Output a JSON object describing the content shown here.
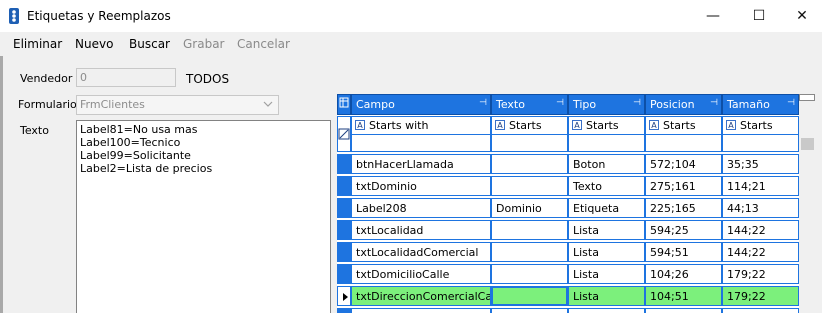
{
  "window": {
    "title": "Etiquetas y Reemplazos",
    "minimize": "—",
    "maximize": "☐",
    "close": "✕"
  },
  "menu": {
    "eliminar": "Eliminar",
    "nuevo": "Nuevo",
    "buscar": "Buscar",
    "grabar": "Grabar",
    "cancelar": "Cancelar"
  },
  "form": {
    "vendedor_label": "Vendedor",
    "vendedor_value": "0",
    "vendedor_desc": "TODOS",
    "formulario_label": "Formulario",
    "formulario_value": "FrmClientes",
    "texto_label": "Texto",
    "texto_lines": [
      "Label81=No usa mas",
      "Label100=Tecnico",
      "Label99=Solicitante",
      "Label2=Lista de precios"
    ]
  },
  "grid": {
    "columns": [
      "Campo",
      "Texto",
      "Tipo",
      "Posicion",
      "Tamaño"
    ],
    "filter_text": [
      "Starts with",
      "Starts",
      "Starts",
      "Starts",
      "Starts"
    ],
    "rows": [
      [
        "btnHacerLlamada",
        "",
        "Boton",
        "572;104",
        "35;35"
      ],
      [
        "txtDominio",
        "",
        "Texto",
        "275;161",
        "114;21"
      ],
      [
        "Label208",
        "Dominio",
        "Etiqueta",
        "225;165",
        "44;13"
      ],
      [
        "txtLocalidad",
        "",
        "Lista",
        "594;25",
        "144;22"
      ],
      [
        "txtLocalidadComercial",
        "",
        "Lista",
        "594;51",
        "144;22"
      ],
      [
        "txtDomicilioCalle",
        "",
        "Lista",
        "104;26",
        "179;22"
      ],
      [
        "txtDireccionComercialCall",
        "",
        "Lista",
        "104;51",
        "179;22"
      ]
    ],
    "active_row": 6,
    "colors": {
      "header": "#1e74e0",
      "active_row": "#7cf07c"
    }
  }
}
